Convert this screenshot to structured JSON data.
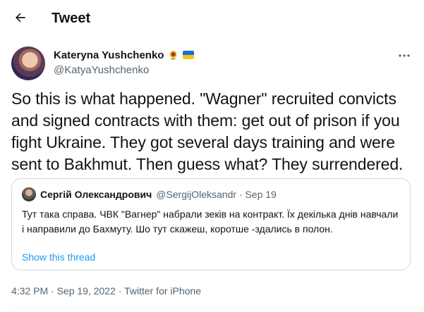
{
  "header": {
    "title": "Tweet"
  },
  "author": {
    "name": "Kateryna Yushchenko",
    "emoji": "🌻",
    "handle": "@KatyaYushchenko"
  },
  "tweet": {
    "text": "So this is what happened. \"Wagner\" recruited convicts and signed contracts with them: get out of prison if you fight Ukraine. They got several days training and were sent to Bakhmut. Then guess what? They surrendered."
  },
  "quote": {
    "name": "Сергій Олександрович",
    "handle_date": "@SergijOleksandr · Sep 19",
    "text": "Тут така справа. ЧВК \"Вагнер\" набрали зеків на контракт. Їх декілька днів навчали і направили до Бахмуту. Шо тут скажеш,  коротше -здались в полон.",
    "show_thread": "Show this thread"
  },
  "meta": {
    "timestamp": "4:32 PM · Sep 19, 2022 · Twitter for iPhone"
  },
  "colors": {
    "link": "#1d9bf0",
    "secondary_text": "#536471",
    "border": "#cfd9de"
  },
  "icons": {
    "back": "arrow-left-icon",
    "more": "more-horizontal-icon"
  }
}
